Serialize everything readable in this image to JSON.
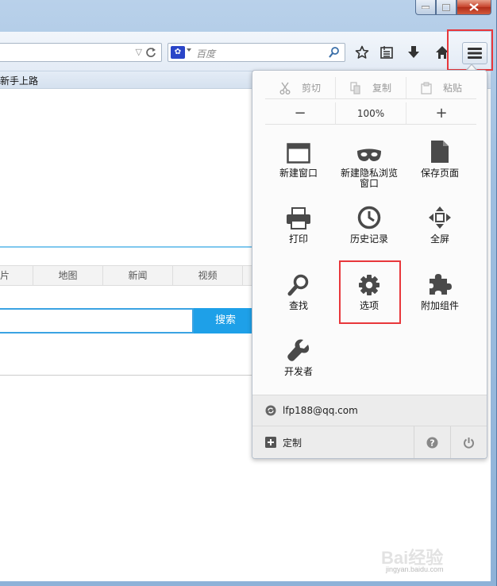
{
  "toolbar": {
    "search_placeholder": "百度",
    "search_engine_icon": "paw-icon"
  },
  "bookmarks": {
    "item_label": "新手上路"
  },
  "baidu_page": {
    "tabs": [
      "片",
      "地图",
      "新闻",
      "视频"
    ],
    "search_button": "搜索"
  },
  "menu": {
    "edit": {
      "cut": "剪切",
      "copy": "复制",
      "paste": "粘贴"
    },
    "zoom": {
      "minus": "−",
      "level": "100%",
      "plus": "+"
    },
    "items": {
      "new_window": "新建窗口",
      "new_private": "新建隐私浏览窗口",
      "save_page": "保存页面",
      "print": "打印",
      "history": "历史记录",
      "fullscreen": "全屏",
      "find": "查找",
      "options": "选项",
      "addons": "附加组件",
      "developer": "开发者"
    },
    "sync_account": "lfp188@qq.com",
    "customize": "定制"
  },
  "watermark": {
    "brand": "Bai经验",
    "url": "jingyan.baidu.com"
  },
  "colors": {
    "highlight": "#e8373b",
    "baidu_blue": "#1ea0e8",
    "accent_line": "#7fc8ee"
  }
}
